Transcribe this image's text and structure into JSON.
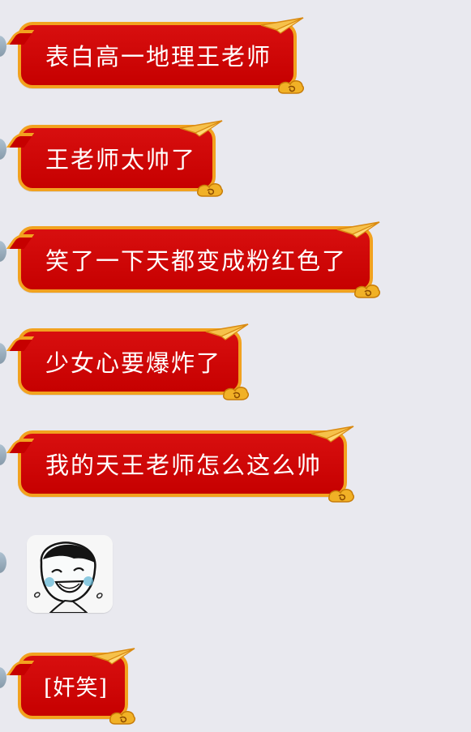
{
  "messages": [
    {
      "text": "表白高一地理王老师",
      "type": "text"
    },
    {
      "text": "王老师太帅了",
      "type": "text"
    },
    {
      "text": "笑了一下天都变成粉红色了",
      "type": "text"
    },
    {
      "text": "少女心要爆炸了",
      "type": "text"
    },
    {
      "text": "我的天王老师怎么这么帅",
      "type": "text"
    },
    {
      "text": "",
      "type": "sticker",
      "sticker_name": "laughing-face-sticker"
    },
    {
      "text": "[奸笑]",
      "type": "text"
    }
  ],
  "colors": {
    "background": "#e9e9ef",
    "bubble": "#c60000",
    "bubble_border": "#f2a21f",
    "text": "#ffffff"
  }
}
